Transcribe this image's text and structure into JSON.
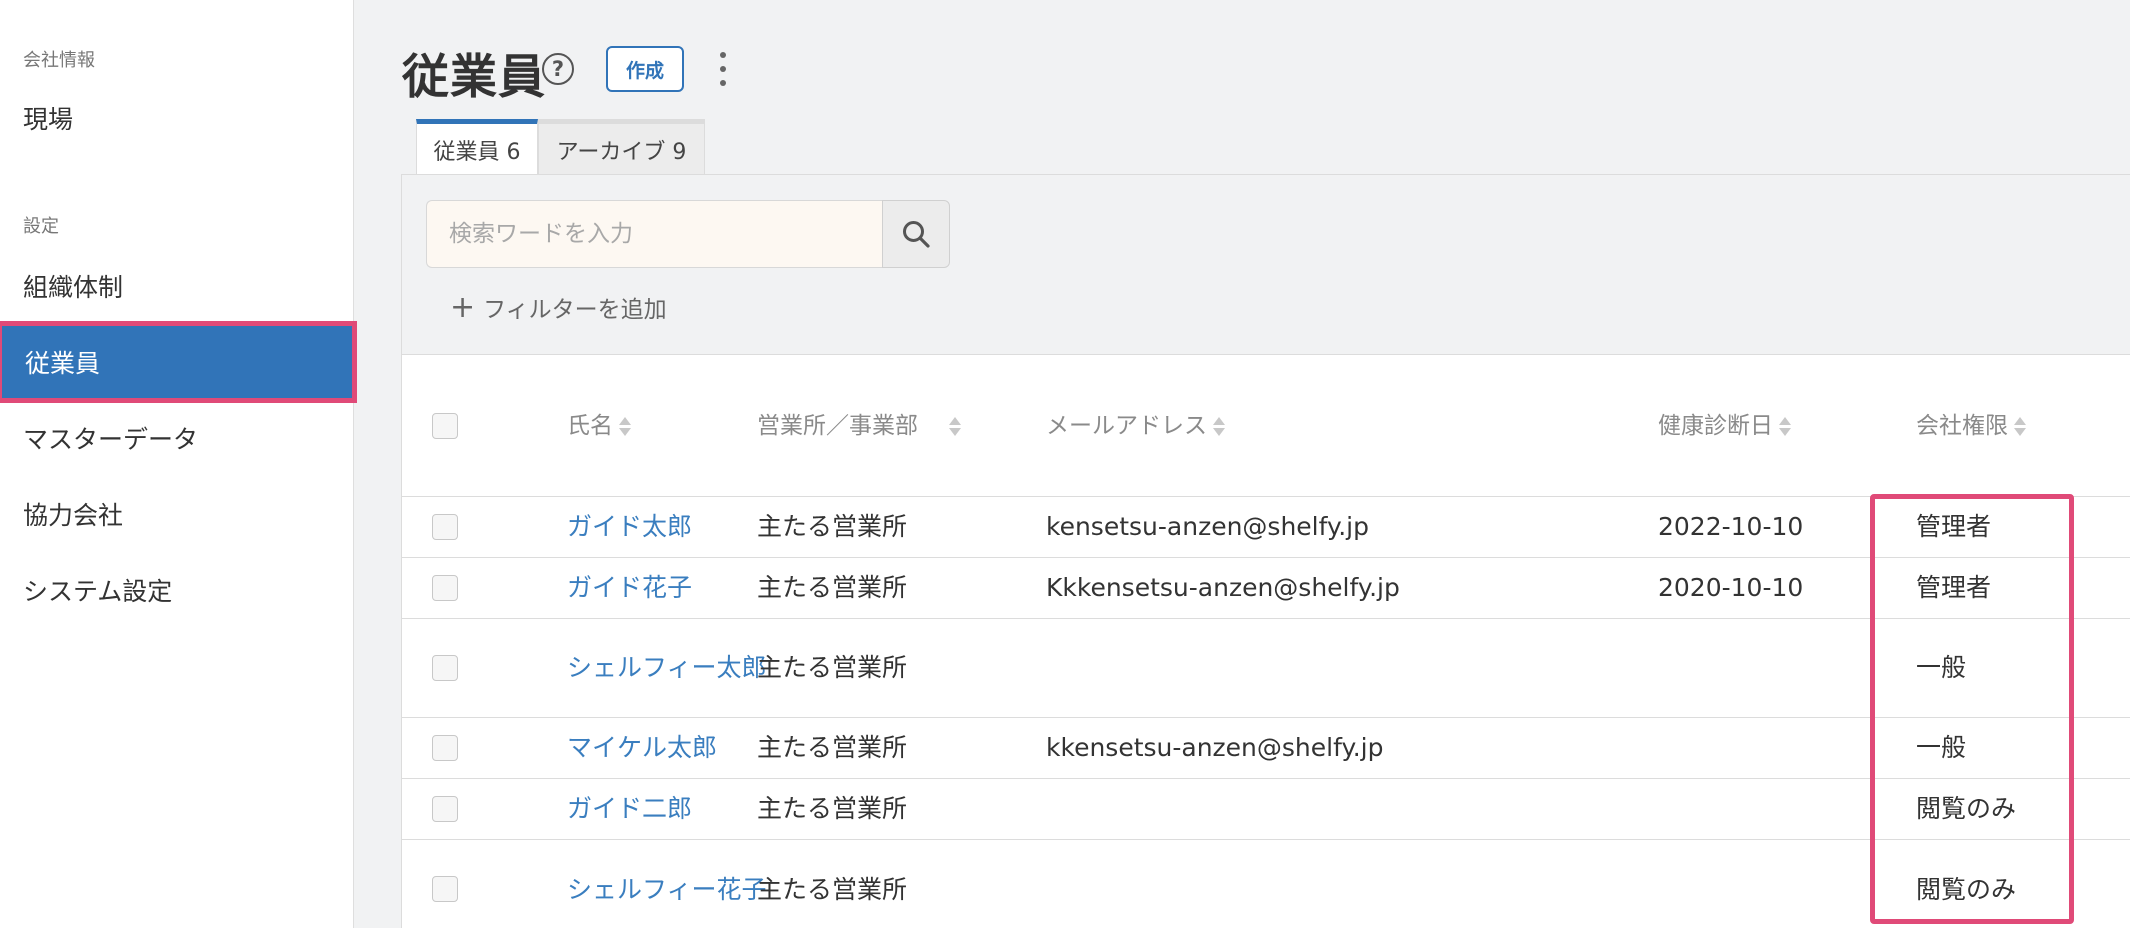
{
  "sidebar": {
    "section_company": "会社情報",
    "section_settings": "設定",
    "items": [
      {
        "label": "現場"
      },
      {
        "label": "組織体制"
      },
      {
        "label": "従業員"
      },
      {
        "label": "マスターデータ"
      },
      {
        "label": "協力会社"
      },
      {
        "label": "システム設定"
      }
    ],
    "active_index": 2
  },
  "header": {
    "title": "従業員",
    "help_icon": "?",
    "create_label": "作成"
  },
  "tabs": [
    {
      "label": "従業員 6",
      "active": true
    },
    {
      "label": "アーカイブ 9",
      "active": false
    }
  ],
  "search": {
    "placeholder": "検索ワードを入力",
    "value": "",
    "add_filter_label": "フィルターを追加",
    "plus_icon": "+"
  },
  "table": {
    "columns": {
      "name": "氏名",
      "office": "営業所／事業部",
      "email": "メールアドレス",
      "health_check": "健康診断日",
      "permission": "会社権限"
    },
    "rows": [
      {
        "name": "ガイド太郎",
        "office": "主たる営業所",
        "email": "kensetsu-anzen@shelfy.jp",
        "health_check": "2022-10-10",
        "permission": "管理者"
      },
      {
        "name": "ガイド花子",
        "office": "主たる営業所",
        "email": "Kkkensetsu-anzen@shelfy.jp",
        "health_check": "2020-10-10",
        "permission": "管理者"
      },
      {
        "name": "シェルフィー太郎",
        "office": "主たる営業所",
        "email": "",
        "health_check": "",
        "permission": "一般"
      },
      {
        "name": "マイケル太郎",
        "office": "主たる営業所",
        "email": "kkensetsu-anzen@shelfy.jp",
        "health_check": "",
        "permission": "一般"
      },
      {
        "name": "ガイド二郎",
        "office": "主たる営業所",
        "email": "",
        "health_check": "",
        "permission": "閲覧のみ"
      },
      {
        "name": "シェルフィー花子",
        "office": "主たる営業所",
        "email": "",
        "health_check": "",
        "permission": "閲覧のみ"
      }
    ]
  },
  "colors": {
    "accent": "#3174b8",
    "highlight": "#e04a78",
    "link": "#3a7ebf"
  }
}
